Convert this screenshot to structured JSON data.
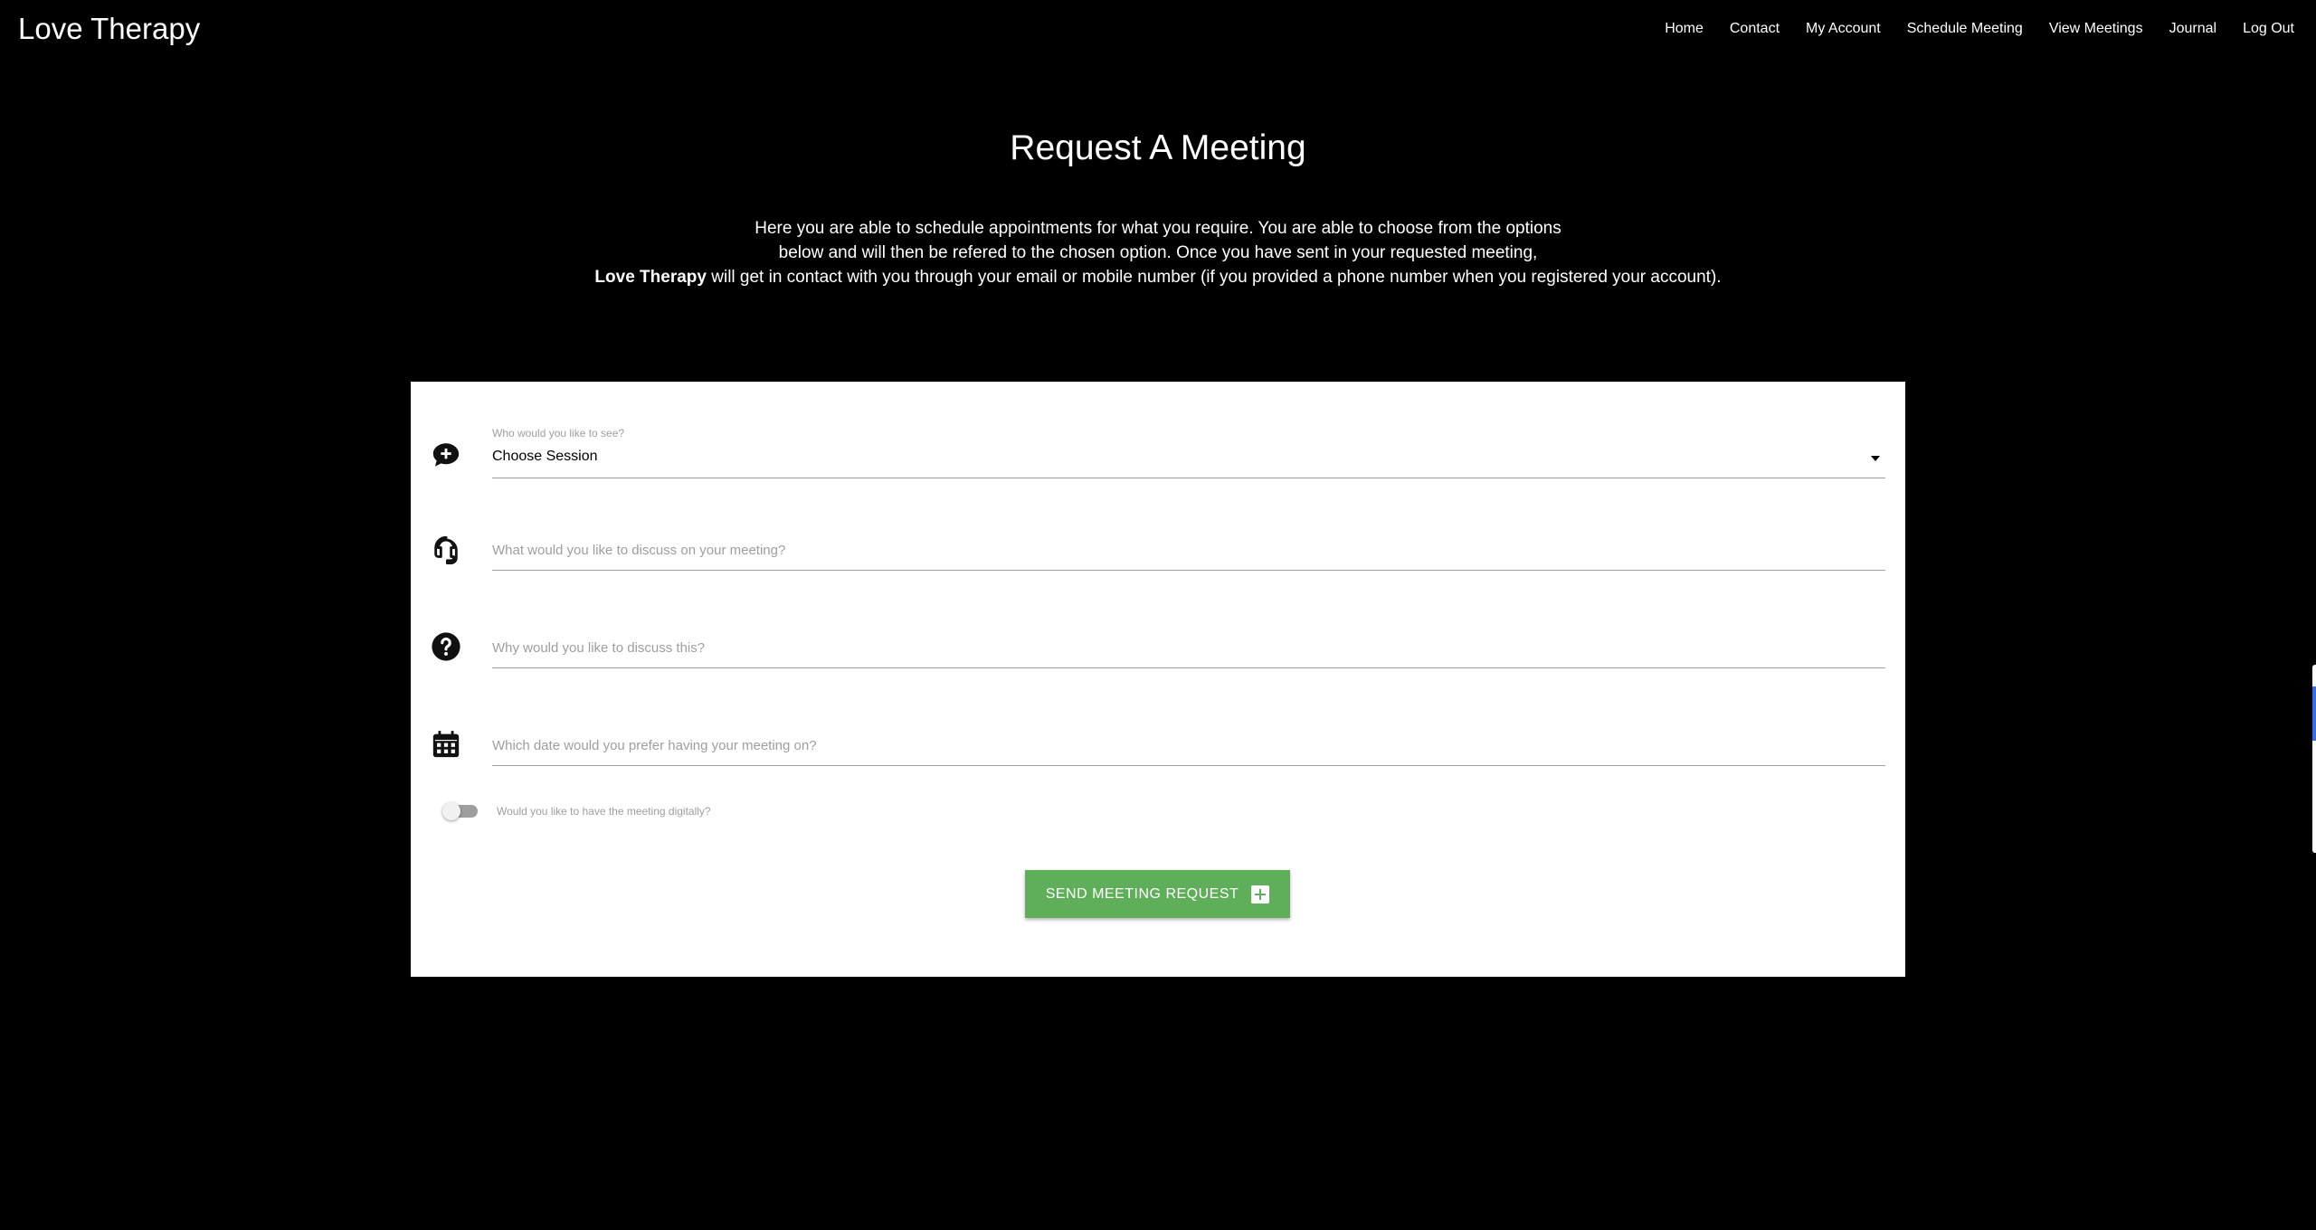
{
  "brand": "Love Therapy",
  "nav": {
    "items": [
      "Home",
      "Contact",
      "My Account",
      "Schedule Meeting",
      "View Meetings",
      "Journal",
      "Log Out"
    ]
  },
  "page": {
    "title": "Request A Meeting",
    "intro_line1": "Here you are able to schedule appointments for what you require. You are able to choose from the options",
    "intro_line2": "below and will then be refered to the chosen option. Once you have sent in your requested meeting,",
    "intro_line3_bold": "Love Therapy",
    "intro_line3_rest": " will get in contact with you through your email or mobile number (if you provided a phone number when you registered your account)."
  },
  "form": {
    "session": {
      "label": "Who would you like to see?",
      "value": "Choose Session"
    },
    "topic": {
      "placeholder": "What would you like to discuss on your meeting?"
    },
    "reason": {
      "placeholder": "Why would you like to discuss this?"
    },
    "date": {
      "placeholder": "Which date would you prefer having your meeting on?"
    },
    "digital": {
      "label": "Would you like to have the meeting digitally?",
      "enabled": false
    },
    "submit_label": "SEND MEETING REQUEST"
  },
  "colors": {
    "background": "#000000",
    "card": "#ffffff",
    "button": "#5faf5a"
  }
}
